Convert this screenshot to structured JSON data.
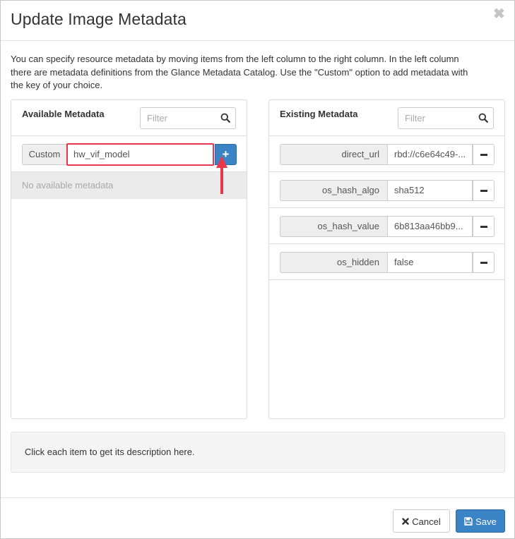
{
  "dialog": {
    "title": "Update Image Metadata",
    "close_symbol": "✖",
    "description": "You can specify resource metadata by moving items from the left column to the right column. In the left column there are metadata definitions from the Glance Metadata Catalog. Use the \"Custom\" option to add metadata with the key of your choice."
  },
  "available": {
    "title": "Available Metadata",
    "filter_placeholder": "Filter",
    "custom_label": "Custom",
    "custom_value": "hw_vif_model",
    "add_symbol": "+",
    "empty_text": "No available metadata"
  },
  "existing": {
    "title": "Existing Metadata",
    "filter_placeholder": "Filter",
    "items": [
      {
        "key": "direct_url",
        "value": "rbd://c6e64c49-..."
      },
      {
        "key": "os_hash_algo",
        "value": "sha512"
      },
      {
        "key": "os_hash_value",
        "value": "6b813aa46bb9..."
      },
      {
        "key": "os_hidden",
        "value": "false"
      }
    ]
  },
  "help_text": "Click each item to get its description here.",
  "footer": {
    "cancel_label": "Cancel",
    "save_label": "Save"
  },
  "icons": {
    "close": "close-icon",
    "search": "search-icon",
    "add": "plus-icon",
    "remove": "minus-icon",
    "cancel": "times-icon",
    "save": "floppy-disk-icon"
  },
  "colors": {
    "primary": "#3a83c4",
    "highlight": "#e8364b",
    "empty_row_bg": "#ebebeb"
  }
}
